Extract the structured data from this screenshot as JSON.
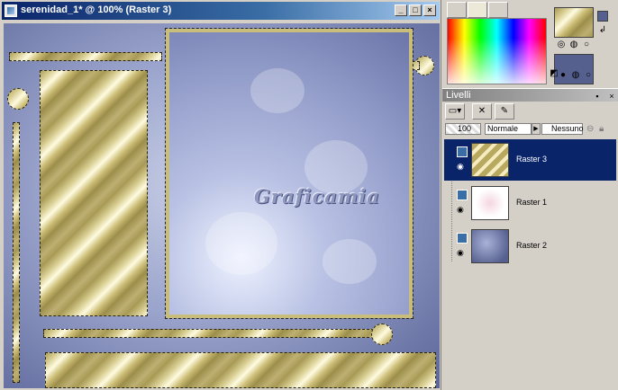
{
  "document": {
    "title": "serenidad_1* @ 100% (Raster 3)",
    "window_buttons": [
      "_",
      "□",
      "×"
    ],
    "watermark": "Graficamia"
  },
  "palette": {
    "tabs": [
      "brush-tab-icon",
      "color-tab-icon",
      "swatches-tab-icon"
    ],
    "foreground_color": "#b8a860",
    "background_color": "#56608f",
    "accent": "#0a246a"
  },
  "layers_panel": {
    "title": "Livelli",
    "opacity": "100",
    "blend_mode": "Normale",
    "mask_mode": "Nessuno",
    "layers": [
      {
        "name": "Raster 3",
        "selected": true
      },
      {
        "name": "Raster 1",
        "selected": false
      },
      {
        "name": "Raster 2",
        "selected": false
      }
    ]
  }
}
